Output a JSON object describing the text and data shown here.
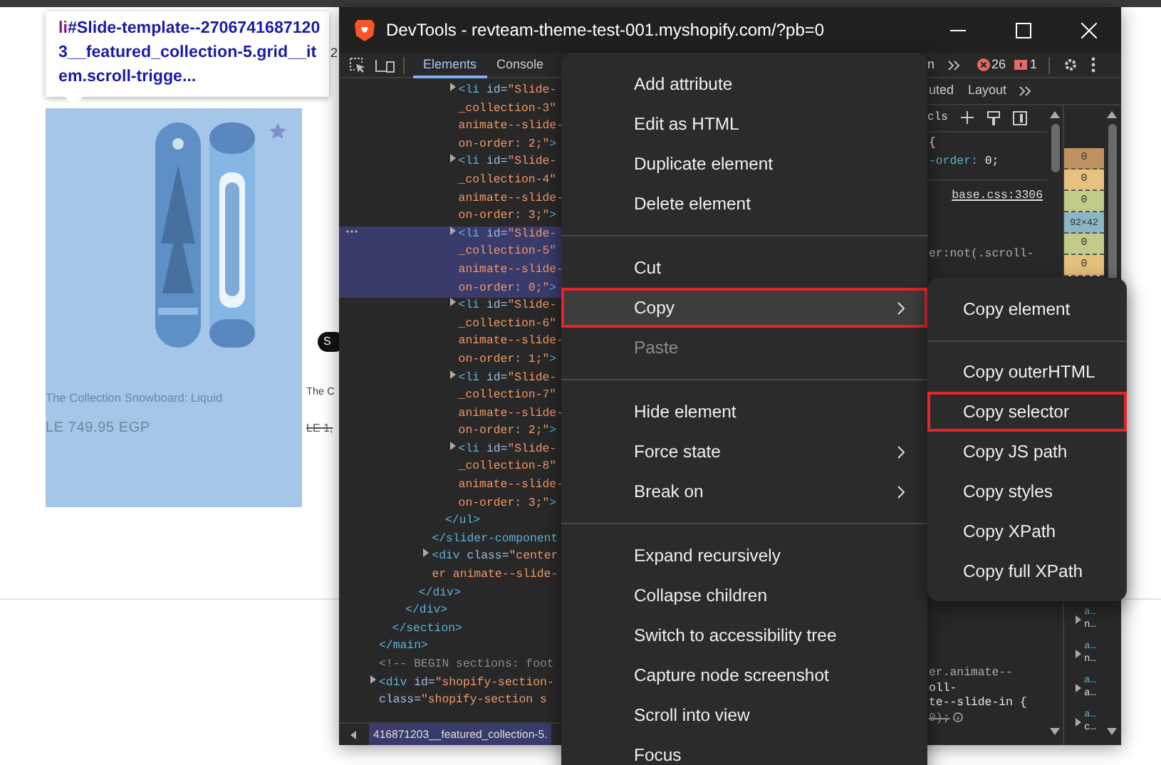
{
  "browser_page": {
    "cut_text": "2",
    "product": {
      "title": "The Collection Snowboard: Liquid",
      "price": "LE 749.95 EGP",
      "highlighted": true
    },
    "next_product": {
      "badge": "S",
      "title": "The C",
      "price": "LE 1,"
    }
  },
  "tooltip": {
    "tag": "li",
    "selector": "#Slide-template--27067416871203__featured_collection-5.grid__item.scroll-trigge..."
  },
  "devtools": {
    "title": "DevTools - revteam-theme-test-001.myshopify.com/?pb=0",
    "tabs": [
      {
        "label": "Elements",
        "selected": true
      },
      {
        "label": "Console",
        "selected": false
      }
    ],
    "cut_tab": "n",
    "error_count": "26",
    "issue_count": "1",
    "sidebar_tabs": [
      {
        "label": "uted",
        "selected": false
      },
      {
        "label": "Layout",
        "selected": false
      }
    ],
    "filter_fragment": "cls",
    "dom_tree": [
      {
        "closing": "</main>",
        "children": [
          {
            "closing": "</section>",
            "children": [
              {
                "closing": "</div>",
                "children": [
                  {
                    "closing": "</div>",
                    "children": [
                      {
                        "closing": "</slider-component",
                        "children": [
                          {
                            "closing": "</ul>",
                            "children": [
                              {
                                "expandable": true,
                                "selected": false,
                                "lines": [
                                  {
                                    "text": "<li id=\"Slide-",
                                    "kind": "tag"
                                  },
                                  {
                                    "text": "_collection-3\"",
                                    "kind": "value"
                                  },
                                  {
                                    "text": "animate--slide-",
                                    "kind": "value"
                                  },
                                  {
                                    "text": "on-order: 2;\">",
                                    "kind": "value"
                                  }
                                ]
                              },
                              {
                                "expandable": true,
                                "selected": false,
                                "lines": [
                                  {
                                    "text": "<li id=\"Slide-",
                                    "kind": "tag"
                                  },
                                  {
                                    "text": "_collection-4\"",
                                    "kind": "value"
                                  },
                                  {
                                    "text": "animate--slide-",
                                    "kind": "value"
                                  },
                                  {
                                    "text": "on-order: 3;\">",
                                    "kind": "value"
                                  }
                                ]
                              },
                              {
                                "expandable": true,
                                "selected": true,
                                "lines": [
                                  {
                                    "text": "<li id=\"Slide-",
                                    "kind": "tag"
                                  },
                                  {
                                    "text": "_collection-5\"",
                                    "kind": "value"
                                  },
                                  {
                                    "text": "animate--slide-",
                                    "kind": "value"
                                  },
                                  {
                                    "text": "on-order: 0;\">",
                                    "kind": "value"
                                  }
                                ]
                              },
                              {
                                "expandable": true,
                                "selected": false,
                                "lines": [
                                  {
                                    "text": "<li id=\"Slide-",
                                    "kind": "tag"
                                  },
                                  {
                                    "text": "_collection-6\"",
                                    "kind": "value"
                                  },
                                  {
                                    "text": "animate--slide-",
                                    "kind": "value"
                                  },
                                  {
                                    "text": "on-order: 1;\">",
                                    "kind": "value"
                                  }
                                ]
                              },
                              {
                                "expandable": true,
                                "selected": false,
                                "lines": [
                                  {
                                    "text": "<li id=\"Slide-",
                                    "kind": "tag"
                                  },
                                  {
                                    "text": "_collection-7\"",
                                    "kind": "value"
                                  },
                                  {
                                    "text": "animate--slide-",
                                    "kind": "value"
                                  },
                                  {
                                    "text": "on-order: 2;\">",
                                    "kind": "value"
                                  }
                                ]
                              },
                              {
                                "expandable": true,
                                "selected": false,
                                "lines": [
                                  {
                                    "text": "<li id=\"Slide-",
                                    "kind": "tag"
                                  },
                                  {
                                    "text": "_collection-8\"",
                                    "kind": "value"
                                  },
                                  {
                                    "text": "animate--slide-",
                                    "kind": "value"
                                  },
                                  {
                                    "text": "on-order: 3;\">",
                                    "kind": "value"
                                  }
                                ]
                              }
                            ]
                          }
                        ]
                      },
                      {
                        "expandable": true,
                        "selected": false,
                        "lines": [
                          {
                            "text": "<div class=\"center",
                            "kind": "tag"
                          },
                          {
                            "text": "er animate--slide-",
                            "kind": "value"
                          }
                        ]
                      }
                    ]
                  }
                ]
              }
            ]
          }
        ]
      },
      {
        "selected": false,
        "lines": [
          {
            "text": "<!-- BEGIN sections: foot",
            "kind": "comment"
          }
        ]
      },
      {
        "expandable": true,
        "selected": false,
        "lines": [
          {
            "text": "<div id=\"shopify-section-",
            "kind": "tag"
          },
          {
            "text": "class=\"shopify-section s",
            "kind": "tag"
          }
        ]
      }
    ],
    "breadcrumb": {
      "text": "416871203__featured_collection-5.",
      "selected": true
    },
    "styles_top": [
      {
        "text": "{",
        "kind": "plain"
      },
      {
        "text": "-order: 0;",
        "kind": "property"
      },
      {
        "text": "base.css:3306",
        "kind": "source"
      },
      {
        "text": "er:not(.scroll-",
        "kind": "selector"
      }
    ],
    "styles_bottom": [
      {
        "text": "er.animate--",
        "kind": "selector"
      },
      {
        "text": "oll-",
        "kind": "plain"
      },
      {
        "text": "te--slide-in {",
        "kind": "plain"
      },
      {
        "text": "0);",
        "kind": "struck"
      }
    ],
    "box_model": [
      {
        "value": "0",
        "color": "#c0925f"
      },
      {
        "value": "0",
        "color": "#e6c27e"
      },
      {
        "value": "0",
        "color": "#c2cb8a"
      },
      {
        "value": "92×42",
        "color": "#8cb6c4"
      },
      {
        "value": "0",
        "color": "#c2cb8a"
      },
      {
        "value": "0",
        "color": "#e6c27e"
      }
    ],
    "computed_items": [
      {
        "name": "a…",
        "value": "n…"
      },
      {
        "name": "a…",
        "value": "n…"
      },
      {
        "name": "a…",
        "value": "a…"
      },
      {
        "name": "a…",
        "value": "c…"
      }
    ]
  },
  "context_menu": [
    {
      "kind": "item",
      "label": "Add attribute",
      "disabled": false,
      "hovered": false,
      "outlined": false
    },
    {
      "kind": "item",
      "label": "Edit as HTML",
      "disabled": false,
      "hovered": false,
      "outlined": false
    },
    {
      "kind": "item",
      "label": "Duplicate element",
      "disabled": false,
      "hovered": false,
      "outlined": false
    },
    {
      "kind": "item",
      "label": "Delete element",
      "disabled": false,
      "hovered": false,
      "outlined": false
    },
    {
      "kind": "separator"
    },
    {
      "kind": "item",
      "label": "Cut",
      "disabled": false,
      "hovered": false,
      "outlined": false
    },
    {
      "kind": "submenu",
      "label": "Copy",
      "disabled": false,
      "hovered": true,
      "outlined": true
    },
    {
      "kind": "item",
      "label": "Paste",
      "disabled": true,
      "hovered": false,
      "outlined": false
    },
    {
      "kind": "separator"
    },
    {
      "kind": "item",
      "label": "Hide element",
      "disabled": false,
      "hovered": false,
      "outlined": false
    },
    {
      "kind": "submenu",
      "label": "Force state",
      "disabled": false,
      "hovered": false,
      "outlined": false
    },
    {
      "kind": "submenu",
      "label": "Break on",
      "disabled": false,
      "hovered": false,
      "outlined": false
    },
    {
      "kind": "separator"
    },
    {
      "kind": "item",
      "label": "Expand recursively",
      "disabled": false,
      "hovered": false,
      "outlined": false
    },
    {
      "kind": "item",
      "label": "Collapse children",
      "disabled": false,
      "hovered": false,
      "outlined": false
    },
    {
      "kind": "item",
      "label": "Switch to accessibility tree",
      "disabled": false,
      "hovered": false,
      "outlined": false
    },
    {
      "kind": "item",
      "label": "Capture node screenshot",
      "disabled": false,
      "hovered": false,
      "outlined": false
    },
    {
      "kind": "item",
      "label": "Scroll into view",
      "disabled": false,
      "hovered": false,
      "outlined": false
    },
    {
      "kind": "item",
      "label": "Focus",
      "disabled": false,
      "hovered": false,
      "outlined": false
    }
  ],
  "copy_submenu": [
    {
      "kind": "item",
      "label": "Copy element",
      "hovered": false,
      "outlined": false
    },
    {
      "kind": "separator"
    },
    {
      "kind": "item",
      "label": "Copy outerHTML",
      "hovered": false,
      "outlined": false
    },
    {
      "kind": "item",
      "label": "Copy selector",
      "hovered": false,
      "outlined": true
    },
    {
      "kind": "item",
      "label": "Copy JS path",
      "hovered": false,
      "outlined": false
    },
    {
      "kind": "item",
      "label": "Copy styles",
      "hovered": false,
      "outlined": false
    },
    {
      "kind": "item",
      "label": "Copy XPath",
      "hovered": false,
      "outlined": false
    },
    {
      "kind": "item",
      "label": "Copy full XPath",
      "hovered": false,
      "outlined": false
    }
  ]
}
